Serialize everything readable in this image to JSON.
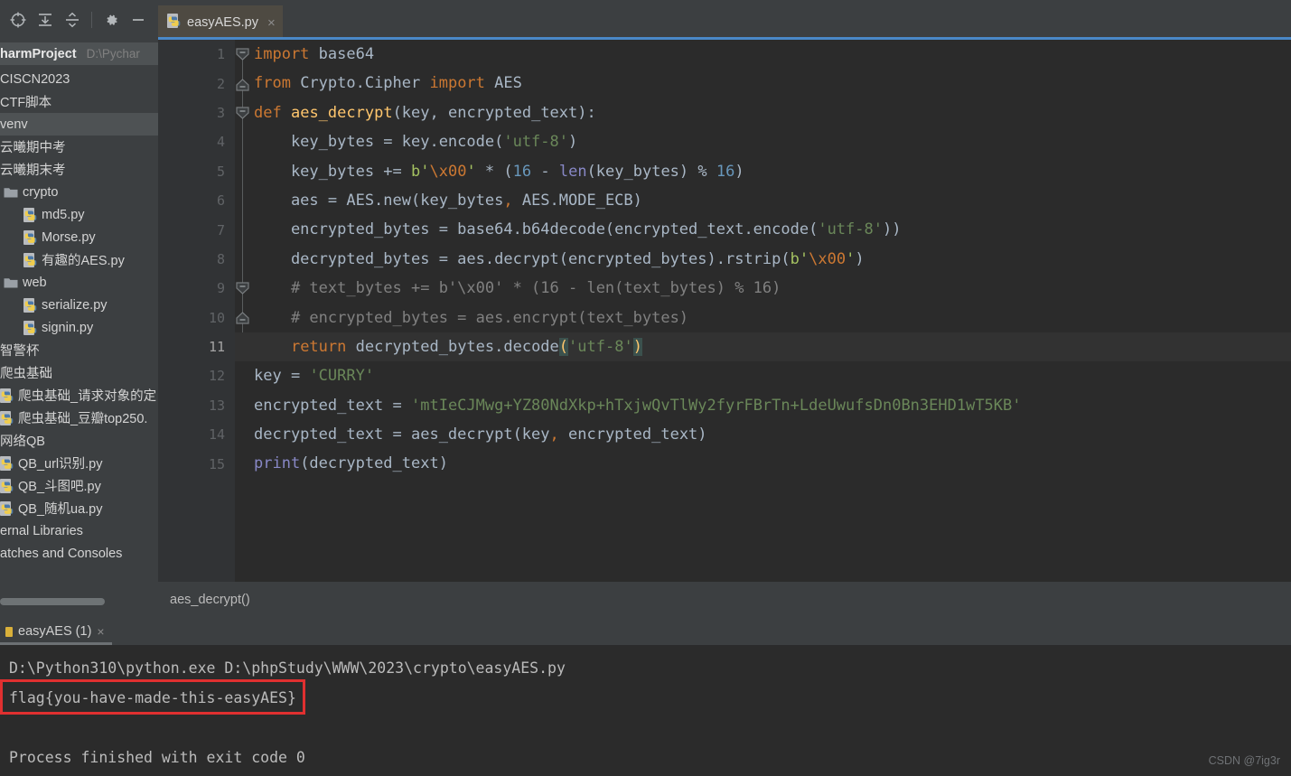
{
  "toolbar": {
    "icons": [
      {
        "name": "locate-icon",
        "label": "Select Opened File"
      },
      {
        "name": "expand-all-icon",
        "label": "Expand All"
      },
      {
        "name": "collapse-all-icon",
        "label": "Collapse All"
      },
      {
        "name": "gear-icon",
        "label": "Options"
      },
      {
        "name": "minimize-icon",
        "label": "Hide"
      }
    ]
  },
  "sidebar": {
    "items": [
      {
        "label": "harmProject",
        "path": "D:\\Pychar",
        "type": "project",
        "bold": true,
        "indent": 0,
        "selected": false,
        "icon": "none"
      },
      {
        "label": "CISCN2023",
        "path": "",
        "type": "folder",
        "bold": false,
        "indent": 0,
        "selected": false,
        "icon": "none"
      },
      {
        "label": "CTF脚本",
        "path": "",
        "type": "folder",
        "bold": false,
        "indent": 0,
        "selected": false,
        "icon": "none"
      },
      {
        "label": "venv",
        "path": "",
        "type": "folder",
        "bold": false,
        "indent": 0,
        "selected": true,
        "icon": "none"
      },
      {
        "label": "云曦期中考",
        "path": "",
        "type": "folder",
        "bold": false,
        "indent": 0,
        "selected": false,
        "icon": "none"
      },
      {
        "label": "云曦期末考",
        "path": "",
        "type": "folder",
        "bold": false,
        "indent": 0,
        "selected": false,
        "icon": "none"
      },
      {
        "label": "crypto",
        "path": "",
        "type": "folder",
        "bold": false,
        "indent": 1,
        "selected": false,
        "icon": "folder"
      },
      {
        "label": "md5.py",
        "path": "",
        "type": "file",
        "bold": false,
        "indent": 2,
        "selected": false,
        "icon": "python"
      },
      {
        "label": "Morse.py",
        "path": "",
        "type": "file",
        "bold": false,
        "indent": 2,
        "selected": false,
        "icon": "python"
      },
      {
        "label": "有趣的AES.py",
        "path": "",
        "type": "file",
        "bold": false,
        "indent": 2,
        "selected": false,
        "icon": "python"
      },
      {
        "label": "web",
        "path": "",
        "type": "folder",
        "bold": false,
        "indent": 1,
        "selected": false,
        "icon": "folder"
      },
      {
        "label": "serialize.py",
        "path": "",
        "type": "file",
        "bold": false,
        "indent": 2,
        "selected": false,
        "icon": "python"
      },
      {
        "label": "signin.py",
        "path": "",
        "type": "file",
        "bold": false,
        "indent": 2,
        "selected": false,
        "icon": "python"
      },
      {
        "label": "智警杯",
        "path": "",
        "type": "folder",
        "bold": false,
        "indent": 0,
        "selected": false,
        "icon": "none"
      },
      {
        "label": "爬虫基础",
        "path": "",
        "type": "folder",
        "bold": false,
        "indent": 0,
        "selected": false,
        "icon": "none"
      },
      {
        "label": "爬虫基础_请求对象的定",
        "path": "",
        "type": "file",
        "bold": false,
        "indent": 0,
        "selected": false,
        "icon": "python"
      },
      {
        "label": "爬虫基础_豆瓣top250.",
        "path": "",
        "type": "file",
        "bold": false,
        "indent": 0,
        "selected": false,
        "icon": "python"
      },
      {
        "label": "网络QB",
        "path": "",
        "type": "folder",
        "bold": false,
        "indent": 0,
        "selected": false,
        "icon": "none"
      },
      {
        "label": "QB_url识别.py",
        "path": "",
        "type": "file",
        "bold": false,
        "indent": 0,
        "selected": false,
        "icon": "python"
      },
      {
        "label": "QB_斗图吧.py",
        "path": "",
        "type": "file",
        "bold": false,
        "indent": 0,
        "selected": false,
        "icon": "python"
      },
      {
        "label": "QB_随机ua.py",
        "path": "",
        "type": "file",
        "bold": false,
        "indent": 0,
        "selected": false,
        "icon": "python"
      },
      {
        "label": "ernal Libraries",
        "path": "",
        "type": "node",
        "bold": false,
        "indent": 0,
        "selected": false,
        "icon": "none"
      },
      {
        "label": "atches and Consoles",
        "path": "",
        "type": "node",
        "bold": false,
        "indent": 0,
        "selected": false,
        "icon": "none"
      }
    ]
  },
  "editor": {
    "tab": {
      "name": "easyAES.py",
      "close": "×",
      "icon": "python-file-icon"
    },
    "breadcrumb": "aes_decrypt()",
    "current_line": 11,
    "line_numbers": [
      "1",
      "2",
      "3",
      "4",
      "5",
      "6",
      "7",
      "8",
      "9",
      "10",
      "11",
      "12",
      "13",
      "14",
      "15"
    ],
    "code_lines": [
      {
        "n": 1,
        "segments": [
          {
            "t": "import",
            "c": "kw"
          },
          {
            "t": " base64",
            "c": "plain"
          }
        ]
      },
      {
        "n": 2,
        "segments": [
          {
            "t": "from",
            "c": "kw"
          },
          {
            "t": " Crypto.Cipher ",
            "c": "plain"
          },
          {
            "t": "import",
            "c": "kw"
          },
          {
            "t": " AES",
            "c": "plain"
          }
        ]
      },
      {
        "n": 3,
        "segments": [
          {
            "t": "def",
            "c": "kw"
          },
          {
            "t": " ",
            "c": "plain"
          },
          {
            "t": "aes_decrypt",
            "c": "fn"
          },
          {
            "t": "(key, encrypted_text):",
            "c": "plain"
          }
        ]
      },
      {
        "n": 4,
        "segments": [
          {
            "t": "    key_bytes = key.encode(",
            "c": "plain"
          },
          {
            "t": "'utf-8'",
            "c": "str"
          },
          {
            "t": ")",
            "c": "plain"
          }
        ]
      },
      {
        "n": 5,
        "segments": [
          {
            "t": "    key_bytes += ",
            "c": "plain"
          },
          {
            "t": "b'",
            "c": "bpfx"
          },
          {
            "t": "\\x00",
            "c": "esc"
          },
          {
            "t": "'",
            "c": "bpfx"
          },
          {
            "t": " * (",
            "c": "plain"
          },
          {
            "t": "16",
            "c": "num"
          },
          {
            "t": " - ",
            "c": "plain"
          },
          {
            "t": "len",
            "c": "bltn"
          },
          {
            "t": "(key_bytes) % ",
            "c": "plain"
          },
          {
            "t": "16",
            "c": "num"
          },
          {
            "t": ")",
            "c": "plain"
          }
        ]
      },
      {
        "n": 6,
        "segments": [
          {
            "t": "    aes = AES.new(key_bytes",
            "c": "plain"
          },
          {
            "t": ",",
            "c": "comma"
          },
          {
            "t": " AES.MODE_ECB)",
            "c": "plain"
          }
        ]
      },
      {
        "n": 7,
        "segments": [
          {
            "t": "    encrypted_bytes = base64.b64decode(encrypted_text.encode(",
            "c": "plain"
          },
          {
            "t": "'utf-8'",
            "c": "str"
          },
          {
            "t": "))",
            "c": "plain"
          }
        ]
      },
      {
        "n": 8,
        "segments": [
          {
            "t": "    decrypted_bytes = aes.decrypt(encrypted_bytes).rstrip(",
            "c": "plain"
          },
          {
            "t": "b'",
            "c": "bpfx"
          },
          {
            "t": "\\x00",
            "c": "esc"
          },
          {
            "t": "'",
            "c": "bpfx"
          },
          {
            "t": ")",
            "c": "plain"
          }
        ]
      },
      {
        "n": 9,
        "segments": [
          {
            "t": "    # text_bytes += b'\\x00' * (16 - len(text_bytes) % 16)",
            "c": "cmt"
          }
        ]
      },
      {
        "n": 10,
        "segments": [
          {
            "t": "    # encrypted_bytes = aes.encrypt(text_bytes)",
            "c": "cmt"
          }
        ]
      },
      {
        "n": 11,
        "segments": [
          {
            "t": "    ",
            "c": "plain"
          },
          {
            "t": "return",
            "c": "kw"
          },
          {
            "t": " decrypted_bytes.decode",
            "c": "plain"
          },
          {
            "t": "(",
            "c": "bracket"
          },
          {
            "t": "'utf-8'",
            "c": "str"
          },
          {
            "t": ")",
            "c": "bracket"
          }
        ]
      },
      {
        "n": 12,
        "segments": [
          {
            "t": "key",
            "c": "plain"
          },
          {
            "t": " = ",
            "c": "plain"
          },
          {
            "t": "'CURRY'",
            "c": "str"
          }
        ]
      },
      {
        "n": 13,
        "segments": [
          {
            "t": "encrypted_text = ",
            "c": "plain"
          },
          {
            "t": "'mtIeCJMwg+YZ80NdXkp+hTxjwQvTlWy2fyrFBrTn+LdeUwufsDn0Bn3EHD1wT5KB'",
            "c": "str"
          }
        ]
      },
      {
        "n": 14,
        "segments": [
          {
            "t": "decrypted_text = aes_decrypt(key",
            "c": "plain"
          },
          {
            "t": ",",
            "c": "comma"
          },
          {
            "t": " encrypted_text)",
            "c": "plain"
          }
        ]
      },
      {
        "n": 15,
        "segments": [
          {
            "t": "print",
            "c": "bltn"
          },
          {
            "t": "(decrypted_text)",
            "c": "plain"
          }
        ]
      }
    ]
  },
  "run_panel": {
    "tab": {
      "name": "easyAES (1)",
      "close": "×"
    },
    "console_lines": [
      {
        "text": "D:\\Python310\\python.exe D:\\phpStudy\\WWW\\2023\\crypto\\easyAES.py",
        "highlight": false
      },
      {
        "text": "flag{you-have-made-this-easyAES}",
        "highlight": true
      },
      {
        "text": "",
        "highlight": false
      },
      {
        "text": "Process finished with exit code 0",
        "highlight": false
      }
    ]
  },
  "watermark": "CSDN @7ig3r",
  "colors": {
    "accent_blue": "#4a88c7",
    "editor_bg": "#2b2b2b",
    "chrome_bg": "#3c3f41",
    "keyword": "#cc7832",
    "string": "#6a8759",
    "number": "#6897bb",
    "function": "#ffc66d",
    "comment": "#808080",
    "builtin": "#8888c6",
    "annotation_red": "#e03030",
    "tab_active": "#4e4a42"
  }
}
